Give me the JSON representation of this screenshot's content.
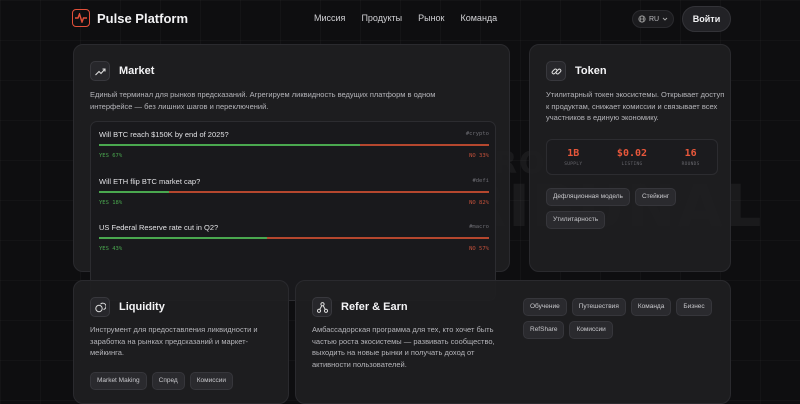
{
  "brand": {
    "name": "Pulse Platform",
    "accent": "#e2503a"
  },
  "nav": {
    "items": [
      "Миссия",
      "Продукты",
      "Рынок",
      "Команда"
    ],
    "lang": "RU",
    "login": "Войти"
  },
  "watermark": {
    "line1": "TRIBUNAL",
    "line2": "CRONOS"
  },
  "market": {
    "title": "Market",
    "icon": "trending-up-icon",
    "description": "Единый терминал для рынков предсказаний. Агрегируем ликвидность ведущих платформ в одном интерфейсе — без лишних шагов и переключений.",
    "rows": [
      {
        "question": "Will BTC reach $150K by end of 2025?",
        "tag": "#crypto",
        "yes_label": "YES 67%",
        "no_label": "NO 33%",
        "yes": 67
      },
      {
        "question": "Will ETH flip BTC market cap?",
        "tag": "#defi",
        "yes_label": "YES 18%",
        "no_label": "NO 82%",
        "yes": 18
      },
      {
        "question": "US Federal Reserve rate cut in Q2?",
        "tag": "#macro",
        "yes_label": "YES 43%",
        "no_label": "NO 57%",
        "yes": 43
      }
    ],
    "colors": {
      "yes": "#4aa84f",
      "no": "#b5472e"
    }
  },
  "token": {
    "title": "Token",
    "icon": "link-icon",
    "description": "Утилитарный токен экосистемы. Открывает доступ к продуктам, снижает комиссии и связывает всех участников в единую экономику.",
    "stats": [
      {
        "value": "1B",
        "label": "SUPPLY"
      },
      {
        "value": "$0.02",
        "label": "LISTING"
      },
      {
        "value": "16",
        "label": "ROUNDS"
      }
    ],
    "chips": [
      "Дефляционная модель",
      "Стейкинг",
      "Утилитарность"
    ]
  },
  "liquidity": {
    "title": "Liquidity",
    "icon": "coins-icon",
    "description": "Инструмент для предоставления ликвидности и заработка на рынках предсказаний и маркет-мейкинга.",
    "chips": [
      "Market Making",
      "Спред",
      "Комиссии"
    ]
  },
  "refer": {
    "title": "Refer & Earn",
    "icon": "network-icon",
    "description": "Амбассадорская программа для тех, кто хочет быть частью роста экосистемы — развивать сообщество, выходить на новые рынки и получать доход от активности пользователей.",
    "chips": [
      "Обучение",
      "Путешествия",
      "Команда",
      "Бизнес",
      "RefShare",
      "Комиссии"
    ]
  }
}
